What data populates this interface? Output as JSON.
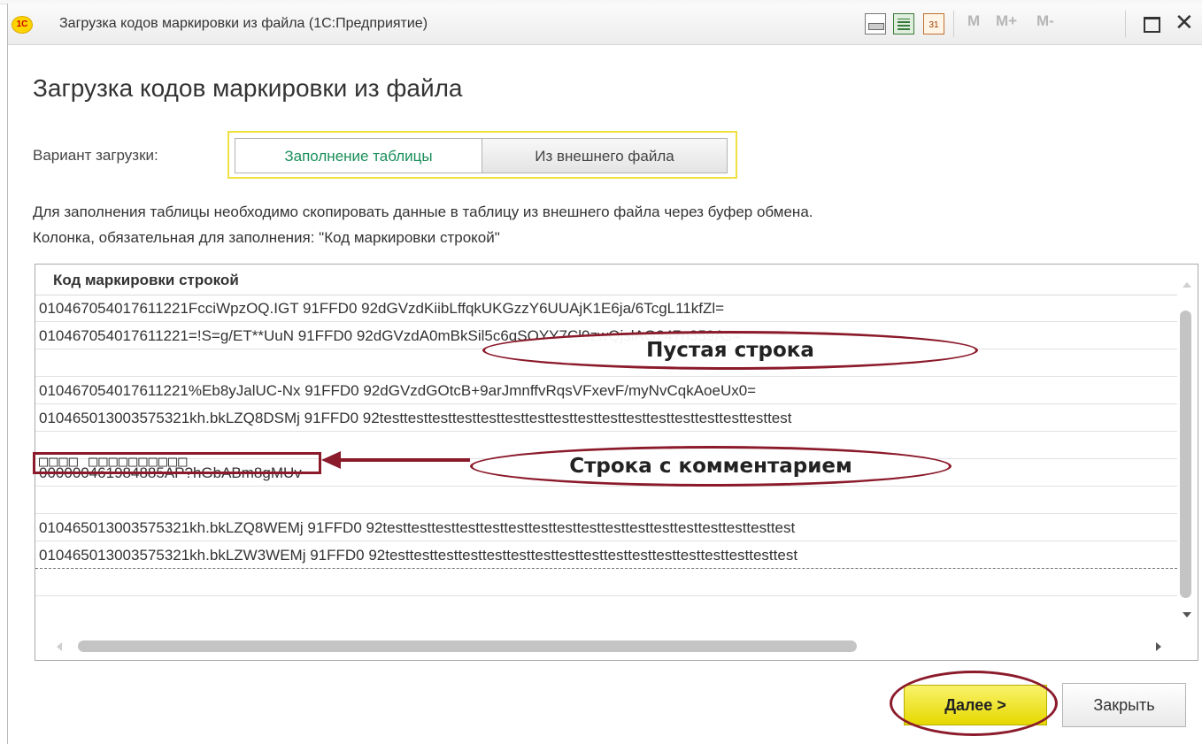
{
  "window": {
    "title": "Загрузка кодов маркировки из файла  (1С:Предприятие)",
    "logo_text": "1С",
    "toolbar": {
      "m": "M",
      "m_plus": "M+",
      "m_minus": "M-",
      "calendar_day": "31",
      "close_glyph": "✕"
    }
  },
  "form": {
    "title": "Загрузка кодов маркировки из файла",
    "variant_label": "Вариант загрузки:",
    "variant_options": [
      "Заполнение таблицы",
      "Из внешнего файла"
    ],
    "variant_selected": "Заполнение таблицы",
    "hint_line1": "Для заполнения таблицы необходимо скопировать данные в таблицу из внешнего файла через буфер обмена.",
    "hint_line2": "Колонка, обязательная для заполнения: \"Код маркировки строкой\""
  },
  "table": {
    "column_header": "Код маркировки строкой",
    "rows": [
      "010467054017611221FcciWpzOQ.IGT 91FFD0 92dGVzdKiibLffqkUKGzzY6UUAjK1E6ja/6TcgL11kfZl=",
      "010467054017611221=!S=g/ET**UuN 91FFD0 92dGVzdA0mBkSil5c6qSQYY7Cl0zwQjslAG247n359As=",
      "",
      "010467054017611221%Eb8yJalUC-Nx 91FFD0 92dGVzdGOtcB+9arJmnffvRqsVFxevF/myNvCqkAoeUx0=",
      "010465013003575321kh.bkLZQ8DSMj 91FFD0 92testtesttesttesttesttesttesttesttesttesttesttesttesttesttesttesttest",
      "□□□□ □□□□□□□□□□",
      "000000461984885AP?hGbABm8gMUv",
      "",
      "010465013003575321kh.bkLZQ8WEMj 91FFD0 92testtesttesttesttesttesttesttesttesttesttesttesttesttesttesttesttest",
      "010465013003575321kh.bkLZW3WEMj 91FFD0 92testtesttesttesttesttesttesttesttesttesttesttesttesttesttesttesttest",
      ""
    ]
  },
  "annotations": {
    "empty_row": "Пустая строка",
    "comment_row": "Строка с комментарием"
  },
  "buttons": {
    "next": "Далее >",
    "close": "Закрыть"
  },
  "colors": {
    "annotation": "#8b1a2b",
    "primary_button": "#e6d800",
    "active_option_text": "#1a8f5a"
  }
}
